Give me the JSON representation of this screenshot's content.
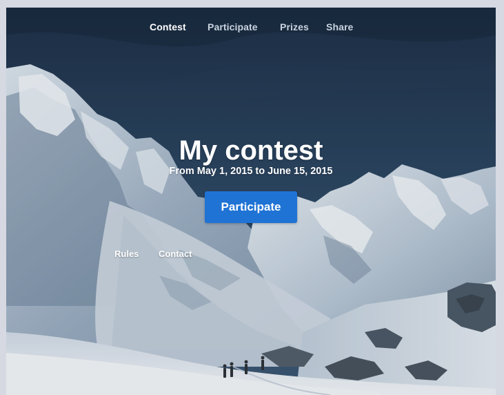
{
  "nav": {
    "items": [
      {
        "label": "Contest",
        "active": true
      },
      {
        "label": "Participate",
        "active": false
      },
      {
        "label": "Prizes",
        "active": false
      },
      {
        "label": "Share",
        "active": false
      }
    ]
  },
  "hero": {
    "title": "My contest",
    "subtitle": "From May 1, 2015 to June 15, 2015",
    "cta_label": "Participate"
  },
  "footer": {
    "links": [
      {
        "label": "Rules"
      },
      {
        "label": "Contact"
      }
    ]
  },
  "colors": {
    "accent": "#1f73d4",
    "text": "#ffffff",
    "nav_inactive": "#c9d3e0"
  }
}
